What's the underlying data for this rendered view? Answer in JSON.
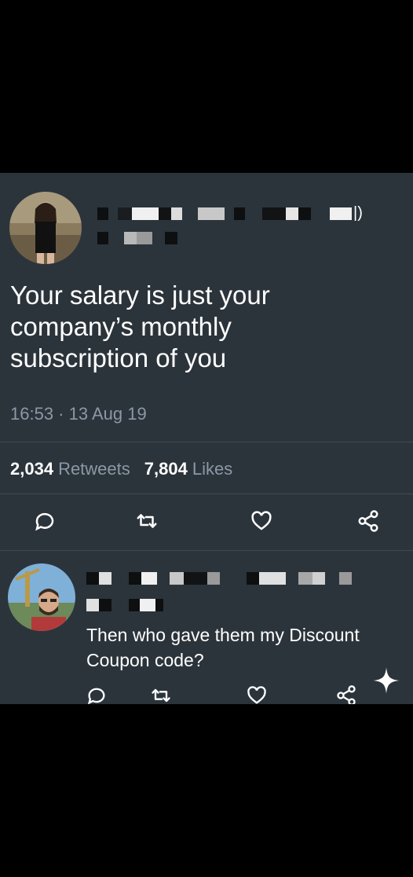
{
  "tweet": {
    "text": "Your salary is just your\ncompany’s monthly\nsubscription of you",
    "timestamp": "16:53 · 13 Aug 19",
    "retweet_count": "2,034",
    "retweet_label": "Retweets",
    "like_count": "7,804",
    "like_label": "Likes",
    "name_trailing": "|)"
  },
  "reply": {
    "text": "Then who gave them my Discount\nCoupon code?"
  },
  "icons": {
    "reply": "reply-icon",
    "retweet": "retweet-icon",
    "like": "heart-icon",
    "share": "share-icon",
    "sparkle": "sparkle-icon"
  },
  "colors": {
    "card_bg": "#2c343b",
    "muted_text": "#8b98a5",
    "primary_text": "#ffffff",
    "icon": "#ffffff"
  }
}
